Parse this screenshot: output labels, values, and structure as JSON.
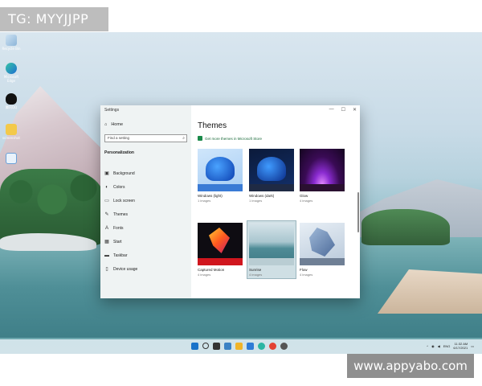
{
  "watermarks": {
    "top": "TG: MYYJJPP",
    "bottom": "www.appyabo.com"
  },
  "desktop": {
    "icons": [
      {
        "label": "Recycle Bin",
        "icon": "recycle-bin-icon"
      },
      {
        "label": "Microsoft Edge",
        "icon": "edge-icon"
      },
      {
        "label": "腾讯QQ",
        "icon": "qq-icon"
      },
      {
        "label": "screenshot",
        "icon": "folder-icon"
      },
      {
        "label": "",
        "icon": "app-icon"
      }
    ]
  },
  "settings": {
    "window_title": "Settings",
    "controls": [
      "—",
      "☐",
      "✕"
    ],
    "home_label": "Home",
    "search_placeholder": "Find a setting",
    "section": "Personalization",
    "nav": [
      {
        "label": "Background",
        "icon": "picture-icon"
      },
      {
        "label": "Colors",
        "icon": "palette-icon"
      },
      {
        "label": "Lock screen",
        "icon": "lock-screen-icon"
      },
      {
        "label": "Themes",
        "icon": "brush-icon"
      },
      {
        "label": "Fonts",
        "icon": "font-icon"
      },
      {
        "label": "Start",
        "icon": "start-icon"
      },
      {
        "label": "Taskbar",
        "icon": "taskbar-icon"
      },
      {
        "label": "Device usage",
        "icon": "device-icon"
      }
    ],
    "page_title": "Themes",
    "store_link": "Get more themes in Microsoft Store",
    "themes": [
      {
        "name": "Windows (light)",
        "count": "1 images",
        "bar_color": "#3a7bd5"
      },
      {
        "name": "Windows (dark)",
        "count": "1 images",
        "bar_color": "#1f2a44"
      },
      {
        "name": "Glow",
        "count": "4 images",
        "bar_color": "#2a1030"
      },
      {
        "name": "Captured Motion",
        "count": "4 images",
        "bar_color": "#d0161e"
      },
      {
        "name": "Sunrise",
        "count": "4 images",
        "bar_color": "#b9cdd3"
      },
      {
        "name": "Flow",
        "count": "4 images",
        "bar_color": "#6f7f95"
      }
    ],
    "selected_theme": "Sunrise"
  },
  "taskbar": {
    "icons": [
      "start-icon",
      "search-icon",
      "task-view-icon",
      "widgets-icon",
      "file-explorer-icon",
      "store-icon",
      "edge-icon",
      "chrome-icon",
      "settings-icon"
    ],
    "tray": {
      "lang": "ENG",
      "time": "11:32 AM",
      "date": "6/17/2021"
    }
  }
}
